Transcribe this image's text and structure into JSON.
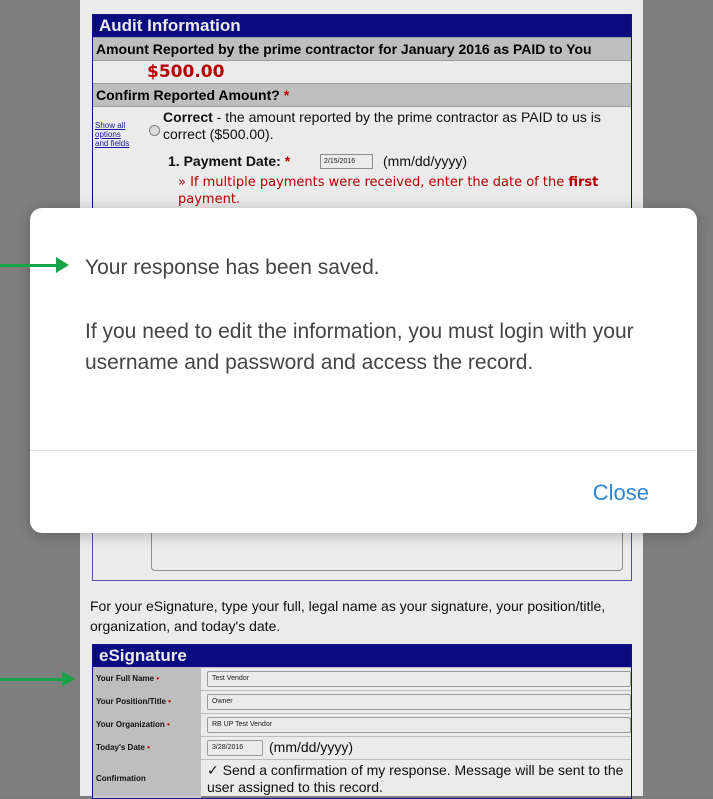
{
  "audit": {
    "title": "Audit Information",
    "amount_heading": "Amount Reported by the prime contractor for January 2016 as PAID to You",
    "amount": "$500.00",
    "confirm_heading": "Confirm Reported Amount?",
    "required_mark": "*",
    "show_all_link": "Show all options and fields",
    "correct_bold": "Correct",
    "correct_rest": " - the amount reported by the prime contractor as PAID to us is correct ($500.00).",
    "payment_date_label": "1. Payment Date:",
    "payment_date_value": "2/15/2016",
    "date_format": "(mm/dd/yyyy)",
    "note_prefix": "» If multiple payments were received, enter the date of the ",
    "note_bold": "first",
    "note_suffix": " payment."
  },
  "esignature": {
    "intro": "For your eSignature, type your full, legal name as your signature, your position/title, organization, and today's date.",
    "title": "eSignature",
    "fields": [
      {
        "label": "Your Full Name",
        "value": "Test Vendor"
      },
      {
        "label": "Your Position/Title",
        "value": "Owner"
      },
      {
        "label": "Your Organization",
        "value": "RB UP Test Vendor"
      }
    ],
    "date_label": "Today's Date",
    "date_value": "3/28/2016",
    "date_format": "(mm/dd/yyyy)",
    "confirmation_label": "Confirmation",
    "confirmation_text": "Send a confirmation of my response. Message will be sent to the user assigned to this record."
  },
  "modal": {
    "message_saved": "Your response has been saved.",
    "message_edit": "If you need to edit the information, you must login with your username and password and access the record.",
    "close_label": "Close"
  },
  "colors": {
    "header_blue": "#0d0d8c",
    "amount_red": "#c40000",
    "arrow_green": "#17a347",
    "link_blue": "#2b88d8"
  }
}
